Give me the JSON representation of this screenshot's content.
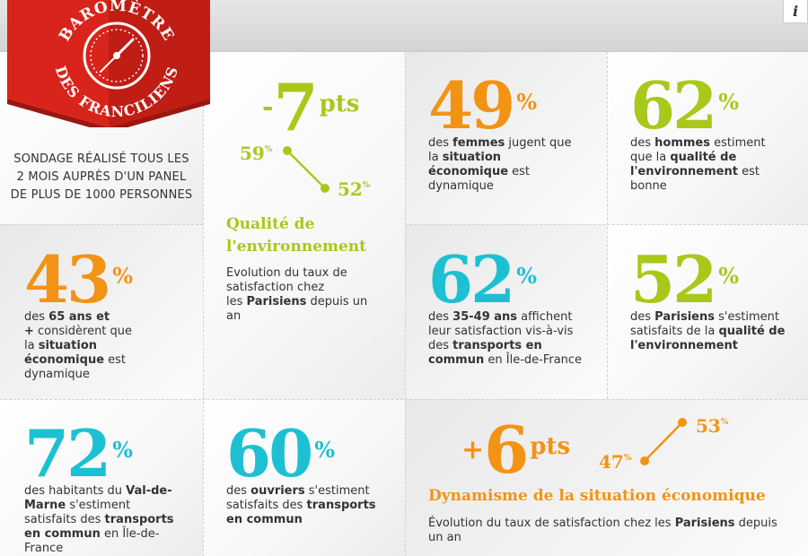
{
  "header": {
    "info_label": "i"
  },
  "badge": {
    "line1": "BAROMÈTRE",
    "line2": "DES FRANCILIENS",
    "color": "#d8241b"
  },
  "intro": {
    "line1": "SONDAGE RÉALISÉ TOUS LES",
    "line2": "2 MOIS AUPRÈS D'UN PANEL",
    "line3": "DE PLUS DE 1000 PERSONNES"
  },
  "trend_env": {
    "sign": "-",
    "value": "7",
    "unit": "pts",
    "from_value": "59",
    "to_value": "52",
    "pct": "%",
    "title_line1": "Qualité de",
    "title_line2": "l'environnement",
    "desc_line1": "Evolution du taux de",
    "desc_line2": "satisfaction chez",
    "desc_line3a": "les ",
    "desc_line3b": "Parisiens",
    "desc_line3c": " depuis un",
    "desc_line4": "an",
    "color": "#a8c81a"
  },
  "trend_eco": {
    "sign": "+",
    "value": "6",
    "unit": "pts",
    "from_value": "47",
    "to_value": "53",
    "pct": "%",
    "title": "Dynamisme de la situation économique",
    "desc_a": "Évolution du taux de satisfaction chez les ",
    "desc_b": "Parisiens",
    "desc_c": " depuis",
    "desc_line2": "un an",
    "color": "#f39313"
  },
  "stats": [
    {
      "value": "49",
      "pct": "%",
      "color": "#f39313",
      "l1a": "des ",
      "l1b": "femmes",
      "l1c": " jugent que",
      "l2a": "la ",
      "l2b": "situation",
      "l3a": "économique",
      "l3b": " est",
      "l4": "dynamique"
    },
    {
      "value": "62",
      "pct": "%",
      "color": "#a8c81a",
      "l1a": "des ",
      "l1b": "hommes",
      "l1c": " estiment",
      "l2a": "que la ",
      "l2b": "qualité de",
      "l3a": "l'environnement",
      "l3b": " est",
      "l4": "bonne"
    },
    {
      "value": "43",
      "pct": "%",
      "color": "#f39313",
      "l1a": "des ",
      "l1b": "65 ans et",
      "l2a": "+",
      "l2b": " considèrent que",
      "l3a": "la ",
      "l3b": "situation",
      "l4a": "économique",
      "l4b": " est",
      "l5": "dynamique"
    },
    {
      "value": "62",
      "pct": "%",
      "color": "#1dc0d3",
      "l1a": "des ",
      "l1b": "35-49 ans",
      "l1c": " affichent",
      "l2": "leur satisfaction vis-à-vis",
      "l3a": "des ",
      "l3b": "transports en",
      "l4a": "commun",
      "l4b": " en Île-de-France"
    },
    {
      "value": "52",
      "pct": "%",
      "color": "#a8c81a",
      "l1a": "des ",
      "l1b": "Parisiens",
      "l1c": " s'estiment",
      "l2a": "satisfaits de la ",
      "l2b": "qualité de",
      "l3": "l'environnement"
    },
    {
      "value": "72",
      "pct": "%",
      "color": "#1dc0d3",
      "l1a": "des habitants du ",
      "l1b": "Val-de-",
      "l2a": "Marne",
      "l2b": " s'estiment",
      "l3a": "satisfaits des ",
      "l3b": "transports",
      "l4a": "en commun",
      "l4b": " en Île-de-",
      "l5": "France"
    },
    {
      "value": "60",
      "pct": "%",
      "color": "#1dc0d3",
      "l1a": "des ",
      "l1b": "ouvriers",
      "l1c": " s'estiment",
      "l2a": "satisfaits des ",
      "l2b": "transports",
      "l3": "en commun"
    }
  ]
}
